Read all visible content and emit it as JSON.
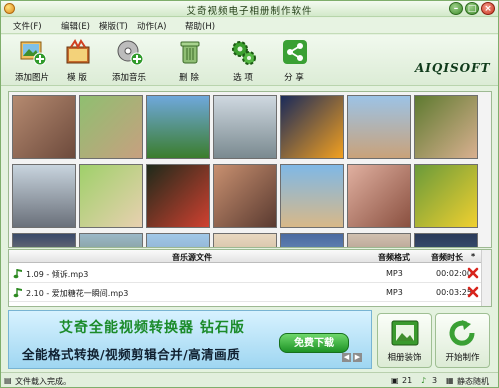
{
  "window": {
    "title": "艾奇视频电子相册制作软件"
  },
  "menu": [
    {
      "label": "文件(F)"
    },
    {
      "label": "编辑(E)"
    },
    {
      "label": "模版(T)"
    },
    {
      "label": "动作(A)"
    },
    {
      "label": "帮助(H)"
    }
  ],
  "toolbar": [
    {
      "label": "添加图片",
      "icon": "add-image-icon"
    },
    {
      "label": "模 版",
      "icon": "template-icon"
    },
    {
      "label": "添加音乐",
      "icon": "add-music-icon"
    },
    {
      "label": "删 除",
      "icon": "trash-icon"
    },
    {
      "label": "选 项",
      "icon": "gears-icon"
    },
    {
      "label": "分 享",
      "icon": "share-icon"
    }
  ],
  "brand": {
    "logo": "AIQISOFT"
  },
  "photo_grid": {
    "rows": 3,
    "cols": 7,
    "visible_thumbnails": 21
  },
  "music_table": {
    "columns": [
      "音乐源文件",
      "音频格式",
      "音频时长",
      "*"
    ],
    "rows": [
      {
        "file": "1.09 - 倾诉.mp3",
        "format": "MP3",
        "duration": "00:02:00"
      },
      {
        "file": "2.10 - 爱加糖花一瞬间.mp3",
        "format": "MP3",
        "duration": "00:03:25"
      }
    ]
  },
  "banner": {
    "headline": "艾奇全能视频转换器 钻石版",
    "subline": "全能格式转换/视频剪辑合并/高清画质",
    "download_label": "免费下载"
  },
  "actions": {
    "decorate_label": "相册装饰",
    "start_label": "开始制作"
  },
  "status": {
    "message": "文件载入完成。",
    "image_count": "21",
    "music_count": "3",
    "transition": "静态随机"
  },
  "colors": {
    "accent": "#3f8e2c",
    "window_bg": "#e4f2df",
    "banner_bg": "#9fd6f1"
  }
}
